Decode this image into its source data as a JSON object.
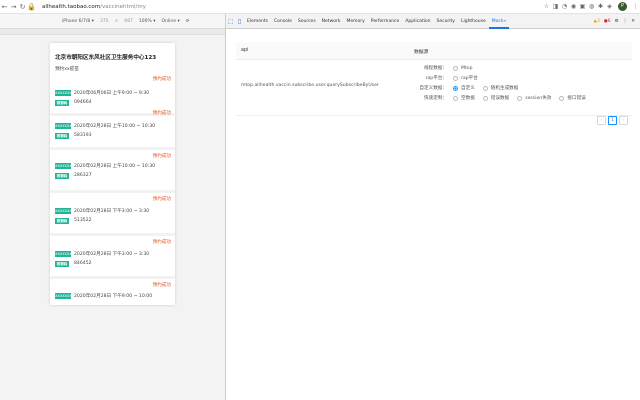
{
  "browser": {
    "url_domain": "allhealth.taobao.com",
    "url_path": "/vaccinehtml/my",
    "avatar_letter": "P"
  },
  "device_toolbar": {
    "device": "iPhone 6/7/8",
    "width": "375",
    "height": "667",
    "zoom": "100%",
    "network": "Online"
  },
  "phone": {
    "title": "北京市朝阳区东风社区卫生服务中心123",
    "subtitle": "预约xx疫苗",
    "cards": [
      {
        "status": "预约成功",
        "tag": "XXXXXXXX",
        "time": "2020年06月06日  上午9:00 ~ 9:30",
        "tag2": "核销码",
        "code": "094664"
      },
      {
        "status": "预约成功",
        "tag": "XXXXXXXX",
        "time": "2020年02月28日  上午10:00 ~ 10:30",
        "tag2": "核销码",
        "code": "583193"
      },
      {
        "status": "预约成功",
        "tag": "XXXXXXXX",
        "time": "2020年02月28日  上午10:00 ~ 10:30",
        "tag2": "核销码",
        "code": "286327"
      },
      {
        "status": "预约成功",
        "tag": "XXXXXXXX",
        "time": "2020年02月28日  下午3:00 ~ 3:30",
        "tag2": "核销码",
        "code": "513522"
      },
      {
        "status": "预约成功",
        "tag": "XXXXXXXX",
        "time": "2020年02月28日  下午3:00 ~ 3:30",
        "tag2": "核销码",
        "code": "846452"
      },
      {
        "status": "预约成功",
        "tag": "XXXXXXXX",
        "time": "2020年02月28日  下午9:00 ~ 10:00",
        "tag2": "",
        "code": ""
      }
    ]
  },
  "devtools": {
    "tabs": [
      "Elements",
      "Console",
      "Sources",
      "Network",
      "Memory",
      "Performance",
      "Application",
      "Security",
      "Lighthouse",
      "Mock»"
    ],
    "active_tab": "Mock»",
    "warn_count": "3",
    "err_count": "6"
  },
  "mock": {
    "col_api": "api",
    "col_source": "数据源",
    "api_name": "mtop.alihealth.vaccin.subscribe.user.querySubscribeByUser",
    "fields": [
      {
        "label": "线程数据：",
        "options": [
          {
            "text": "Mtop",
            "on": false
          }
        ]
      },
      {
        "label": "rap平台：",
        "options": [
          {
            "text": "rap平台",
            "on": false
          }
        ]
      },
      {
        "label": "自定义数据：",
        "options": [
          {
            "text": "自定义",
            "on": true
          },
          {
            "text": "随机生成数据",
            "on": false
          }
        ]
      },
      {
        "label": "快速定制：",
        "options": [
          {
            "text": "空数据",
            "on": false
          },
          {
            "text": "错误数据",
            "on": false
          },
          {
            "text": "session失效",
            "on": false
          },
          {
            "text": "接口错误",
            "on": false
          }
        ]
      }
    ],
    "pager": {
      "prev": "‹",
      "page": "1",
      "next": "›"
    }
  },
  "colors": {
    "accent": "#1890ff",
    "success_tag": "#1fb595",
    "status": "#e9531f"
  }
}
